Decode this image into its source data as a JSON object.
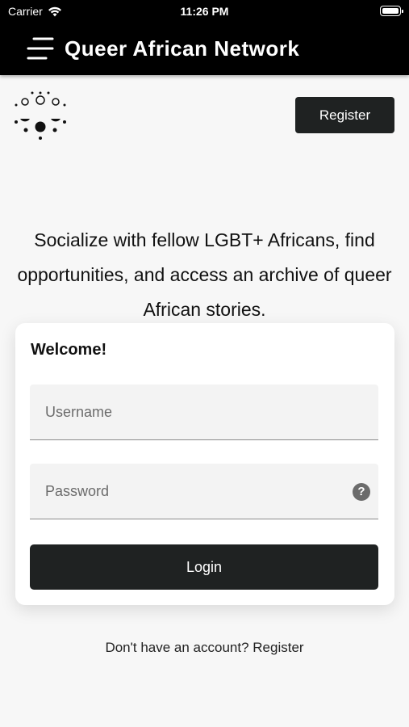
{
  "status_bar": {
    "carrier": "Carrier",
    "time": "11:26 PM",
    "icons": [
      "wifi-icon",
      "battery-icon"
    ]
  },
  "app_bar": {
    "title": "Queer African Network",
    "menu_icon": "menu-icon"
  },
  "header": {
    "logo_icon": "dots-logo-icon",
    "register_label": "Register"
  },
  "tagline": "Socialize with fellow LGBT+ Africans, find opportunities, and access an archive of queer African stories.",
  "login_card": {
    "welcome": "Welcome!",
    "username_placeholder": "Username",
    "username_value": "",
    "password_placeholder": "Password",
    "password_value": "",
    "help_icon": "?",
    "login_label": "Login"
  },
  "footer": {
    "register_prompt": "Don't have an account? Register"
  },
  "colors": {
    "app_bar": "#000000",
    "background": "#f7f7f7",
    "button": "#1f2222",
    "card": "#ffffff"
  }
}
